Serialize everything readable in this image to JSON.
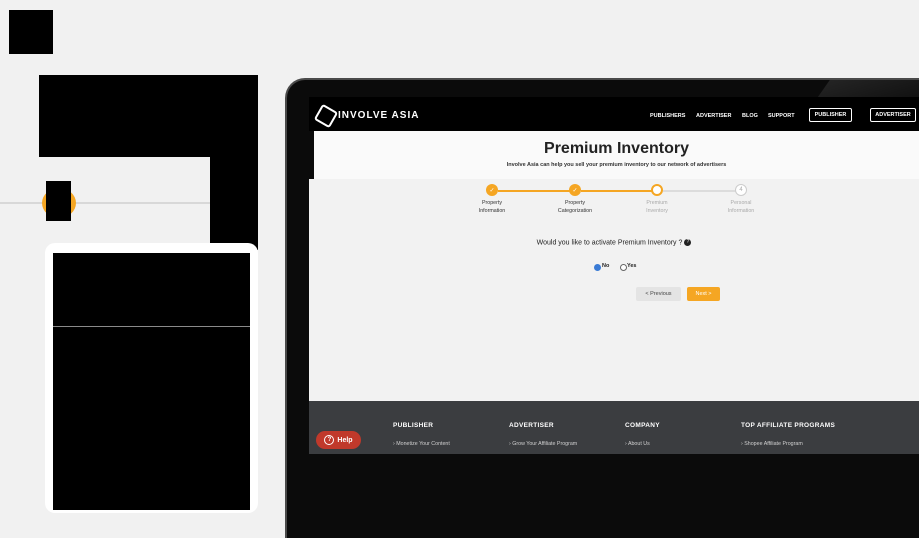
{
  "nav": {
    "logo": "INVOLVE ASIA",
    "links": [
      "PUBLISHERS",
      "ADVERTISER",
      "BLOG",
      "SUPPORT"
    ],
    "buttons": [
      "PUBLISHER",
      "ADVERTISER"
    ]
  },
  "hero": {
    "title": "Premium Inventory",
    "subtitle": "Involve Asia can help you sell your premium inventory to our network of advertisers"
  },
  "steps": [
    {
      "line1": "Property",
      "line2": "Information",
      "state": "done"
    },
    {
      "line1": "Property",
      "line2": "Categorization",
      "state": "done"
    },
    {
      "line1": "Premium",
      "line2": "Inventory",
      "state": "current"
    },
    {
      "line1": "Personal",
      "line2": "Information",
      "state": "pending",
      "number": "4"
    }
  ],
  "form": {
    "question": "Would you like to activate Premium Inventory ?",
    "options": [
      "No",
      "Yes"
    ],
    "selected": "No",
    "prev_label": "< Previous",
    "next_label": "Next >"
  },
  "footer": {
    "columns": [
      {
        "heading": "PUBLISHER",
        "link": "Monetize Your Content"
      },
      {
        "heading": "ADVERTISER",
        "link": "Grow Your Affiliate Program"
      },
      {
        "heading": "COMPANY",
        "link": "About Us"
      },
      {
        "heading": "TOP AFFILIATE PROGRAMS",
        "link": "Shopee Affiliate Program"
      }
    ],
    "help_label": "Help"
  },
  "colors": {
    "accent": "#f5a623",
    "help": "#c0392b",
    "footer_bg": "#3b3d40"
  },
  "icons": [
    "logo-hexagon-icon",
    "check-icon",
    "question-circle-icon",
    "chevron-right-icon"
  ]
}
